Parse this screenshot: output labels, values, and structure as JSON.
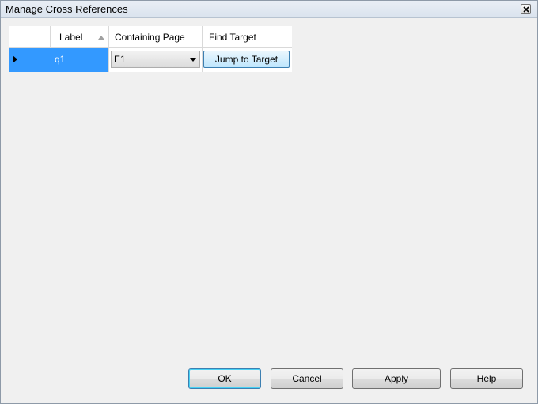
{
  "window": {
    "title": "Manage Cross References"
  },
  "grid": {
    "headers": [
      "",
      "Label",
      "Containing Page",
      "Find Target"
    ],
    "rows": [
      {
        "label": "q1",
        "containing_page": "E1",
        "find_target": "Jump to Target"
      }
    ],
    "colors": {
      "selection": "#3399ff"
    }
  },
  "buttons": {
    "ok": "OK",
    "cancel": "Cancel",
    "apply": "Apply",
    "help": "Help"
  }
}
